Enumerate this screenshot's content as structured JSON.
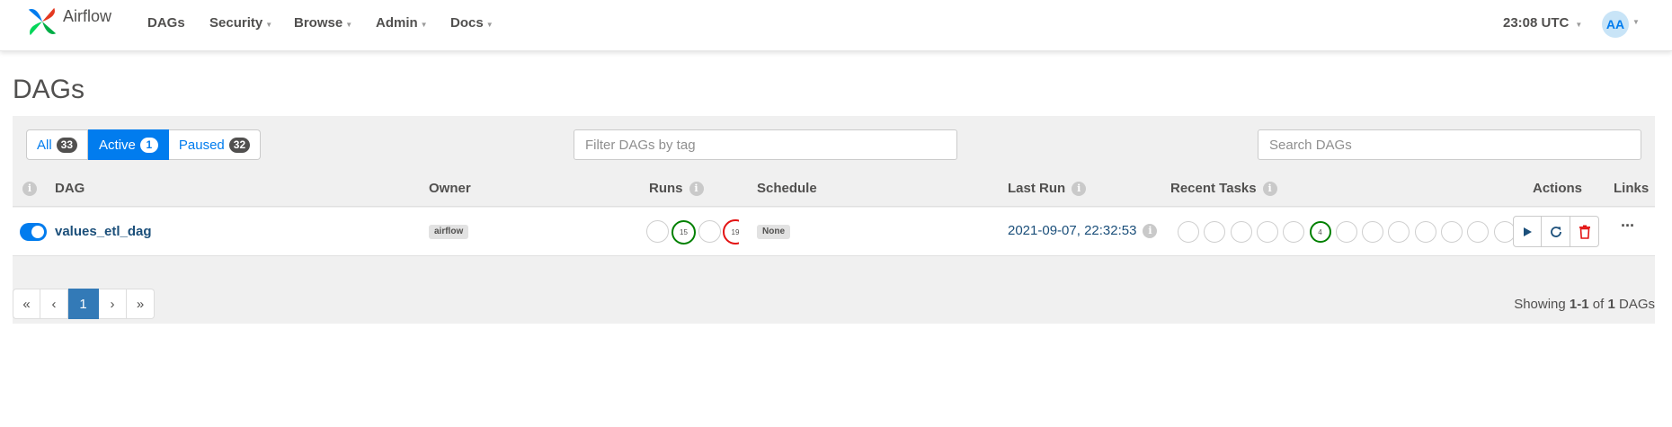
{
  "navbar": {
    "brand": "Airflow",
    "items": [
      {
        "label": "DAGs",
        "caret": false
      },
      {
        "label": "Security",
        "caret": true
      },
      {
        "label": "Browse",
        "caret": true
      },
      {
        "label": "Admin",
        "caret": true
      },
      {
        "label": "Docs",
        "caret": true
      }
    ],
    "clock": "23:08 UTC",
    "user_initials": "AA"
  },
  "page_title": "DAGs",
  "filters": {
    "all_label": "All",
    "all_count": "33",
    "active_label": "Active",
    "active_count": "1",
    "paused_label": "Paused",
    "paused_count": "32",
    "tag_placeholder": "Filter DAGs by tag",
    "search_placeholder": "Search DAGs"
  },
  "table": {
    "headers": {
      "dag": "DAG",
      "owner": "Owner",
      "runs": "Runs",
      "schedule": "Schedule",
      "last_run": "Last Run",
      "recent_tasks": "Recent Tasks",
      "actions": "Actions",
      "links": "Links"
    },
    "rows": [
      {
        "dag_id": "values_etl_dag",
        "paused": false,
        "owner": "airflow",
        "runs": [
          {
            "state": "queued",
            "count": ""
          },
          {
            "state": "success",
            "count": "15"
          },
          {
            "state": "running",
            "count": ""
          },
          {
            "state": "failed",
            "count": "19"
          }
        ],
        "schedule": "None",
        "last_run": "2021-09-07, 22:32:53",
        "recent_tasks": [
          "",
          "",
          "",
          "",
          "",
          "4",
          "",
          "",
          "",
          "",
          "",
          "",
          ""
        ],
        "recent_tasks_success_index": 5,
        "actions": [
          "trigger-icon",
          "refresh-icon",
          "delete-icon"
        ],
        "links_icon": "ellipsis-icon"
      }
    ]
  },
  "pagination": {
    "first": "«",
    "prev": "‹",
    "current": "1",
    "next": "›",
    "last": "»"
  },
  "showing": {
    "prefix": "Showing ",
    "range": "1-1",
    "mid": " of ",
    "total": "1",
    "suffix": " DAGs"
  },
  "colors": {
    "accent": "#017cee",
    "link": "#1b4f7a",
    "success": "#008000",
    "failed": "#e31313",
    "delete": "#e31313",
    "pager_active": "#337ab7"
  }
}
